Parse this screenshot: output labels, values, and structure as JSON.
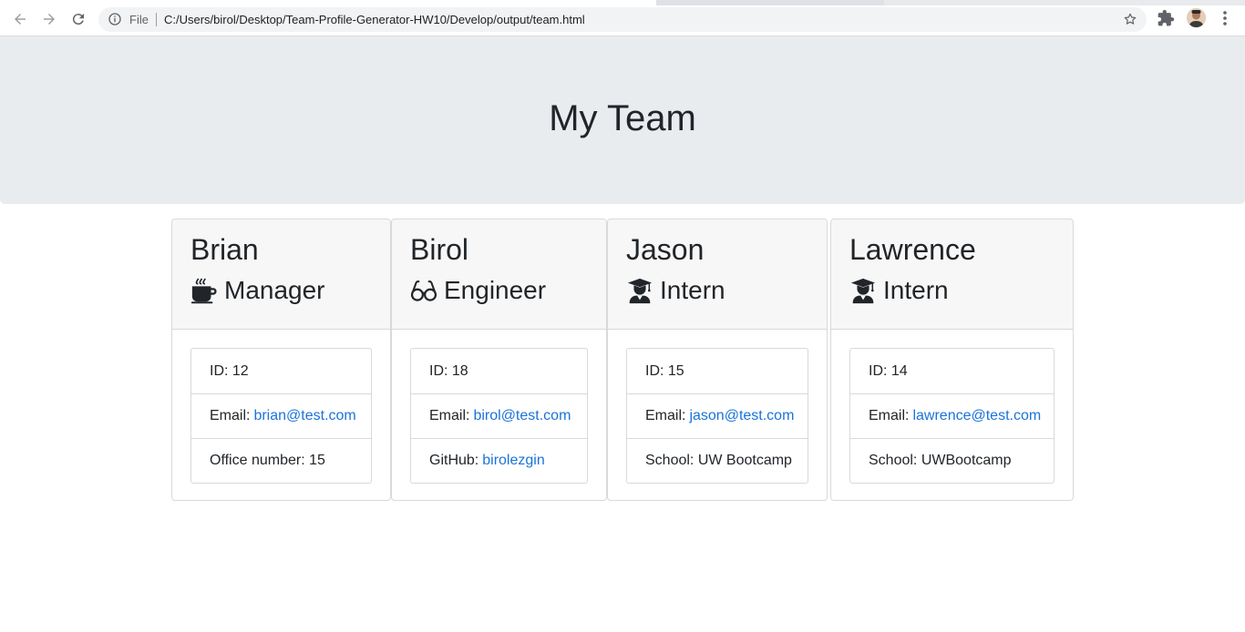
{
  "browser": {
    "file_label": "File",
    "url": "C:/Users/birol/Desktop/Team-Profile-Generator-HW10/Develop/output/team.html"
  },
  "page": {
    "title": "My Team"
  },
  "team": [
    {
      "name": "Brian",
      "role": "Manager",
      "icon": "coffee-icon",
      "id_text": "ID: 12",
      "email_label": "Email:",
      "email": "brian@test.com",
      "extra_text": "Office number: 15",
      "extra_label": "",
      "extra_link": ""
    },
    {
      "name": "Birol",
      "role": "Engineer",
      "icon": "glasses-icon",
      "id_text": "ID: 18",
      "email_label": "Email:",
      "email": "birol@test.com",
      "extra_text": "",
      "extra_label": "GitHub:",
      "extra_link": "birolezgin"
    },
    {
      "name": "Jason",
      "role": "Intern",
      "icon": "graduate-icon",
      "id_text": "ID: 15",
      "email_label": "Email:",
      "email": "jason@test.com",
      "extra_text": "School: UW Bootcamp",
      "extra_label": "",
      "extra_link": ""
    },
    {
      "name": "Lawrence",
      "role": "Intern",
      "icon": "graduate-icon",
      "id_text": "ID: 14",
      "email_label": "Email:",
      "email": "lawrence@test.com",
      "extra_text": "School: UWBootcamp",
      "extra_label": "",
      "extra_link": ""
    }
  ],
  "colors": {
    "jumbotron_bg": "#e9ecef",
    "link": "#1a73d9",
    "card_header_bg": "#f7f7f7"
  }
}
